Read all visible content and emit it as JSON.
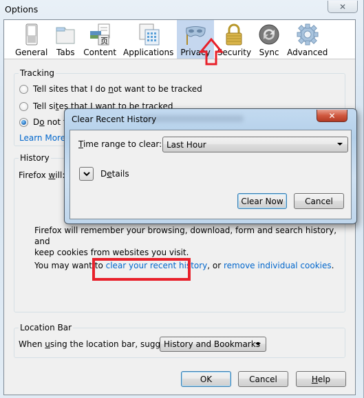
{
  "window": {
    "title": "Options",
    "close_glyph": "✕"
  },
  "toolbar": {
    "items": [
      {
        "label": "General",
        "icon": "general-switch-icon",
        "selected": false
      },
      {
        "label": "Tabs",
        "icon": "tabs-folder-icon",
        "selected": false
      },
      {
        "label": "Content",
        "icon": "content-page-icon",
        "selected": false
      },
      {
        "label": "Applications",
        "icon": "applications-window-icon",
        "selected": false
      },
      {
        "label": "Privacy",
        "icon": "privacy-mask-icon",
        "selected": true
      },
      {
        "label": "Security",
        "icon": "security-padlock-icon",
        "selected": false
      },
      {
        "label": "Sync",
        "icon": "sync-arrows-icon",
        "selected": false
      },
      {
        "label": "Advanced",
        "icon": "advanced-gear-icon",
        "selected": false
      }
    ]
  },
  "tracking": {
    "label": "Tracking",
    "options": [
      {
        "pre": "Tell sites that I do ",
        "u": "n",
        "post": "ot want to be tracked",
        "selected": false
      },
      {
        "pre": "Tell si",
        "u": "t",
        "post": "es that I want to be tracked",
        "selected": false
      },
      {
        "pre": "D",
        "u": "o",
        "post": " not tell sites anything about my tracking preferences",
        "visible_text": "Do not te",
        "selected": true
      }
    ],
    "learn_more": "Learn More"
  },
  "history": {
    "label": "History",
    "firefox_will_pre": "Firefox ",
    "firefox_will_u": "w",
    "firefox_will_post": "ill:",
    "description_line1": "Firefox will remember your browsing, download, form and search history, and",
    "description_line2": "keep cookies from websites you visit.",
    "may_want_pre": "You may want to ",
    "clear_link": "clear your recent history",
    "comma_or": ", or ",
    "remove_link": "remove individual cookies",
    "period": "."
  },
  "location_bar": {
    "label": "Location Bar",
    "suggest_pre": "When ",
    "suggest_u": "u",
    "suggest_post": "sing the location bar, suggest:",
    "suggest_value": "History and Bookmarks"
  },
  "buttons": {
    "ok": "OK",
    "cancel": "Cancel",
    "help_u": "H",
    "help_rest": "elp"
  },
  "modal": {
    "title": "Clear Recent History",
    "close_glyph": "✕",
    "time_range_u": "T",
    "time_range_rest": "ime range to clear:",
    "time_range_value": "Last Hour",
    "details_pre": "D",
    "details_u": "e",
    "details_post": "tails",
    "clear_now": "Clear Now",
    "cancel": "Cancel"
  },
  "annotations": {
    "color": "#e8202a"
  }
}
